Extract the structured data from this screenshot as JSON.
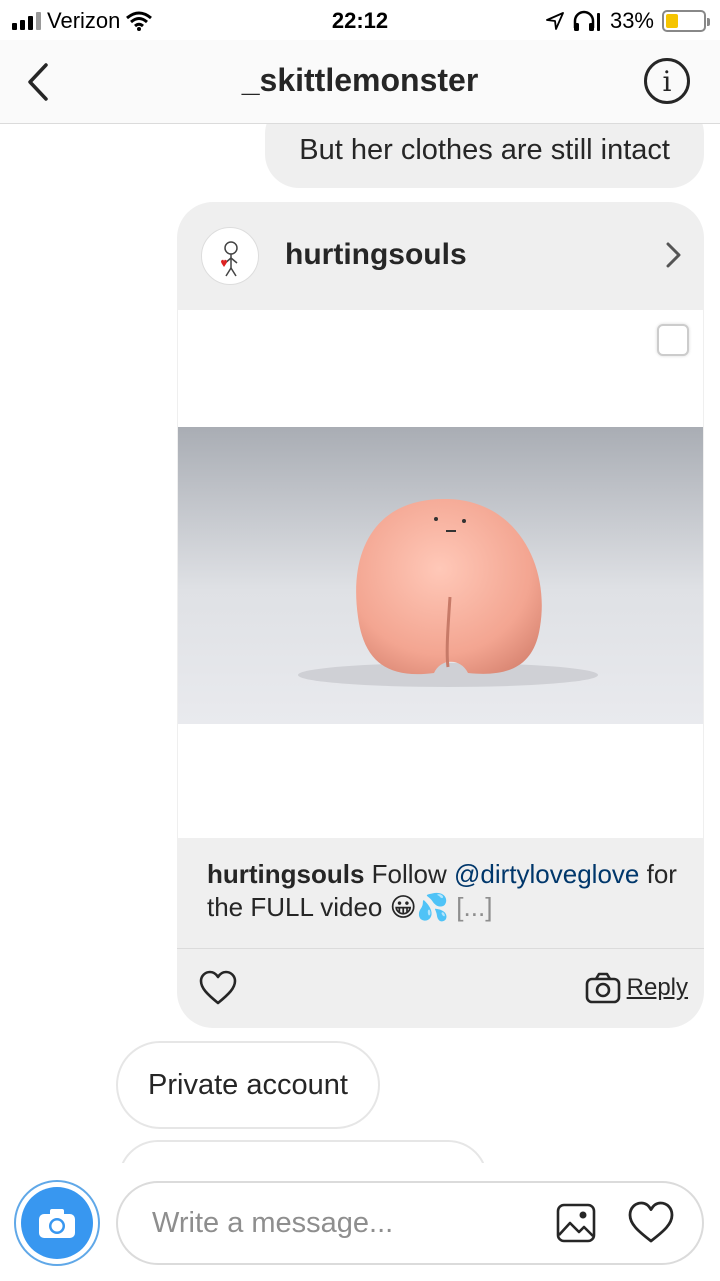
{
  "status_bar": {
    "carrier": "Verizon",
    "time": "22:12",
    "battery_percent": "33%",
    "battery_level": 0.33,
    "battery_color": "#f5c400",
    "icons": [
      "signal-icon",
      "wifi-icon",
      "location-arrow-icon",
      "headphones-icon",
      "battery-icon"
    ]
  },
  "header": {
    "title": "_skittlemonster",
    "back_icon": "chevron-left-icon",
    "info_label": "i"
  },
  "messages": {
    "top_text": "But her clothes are still intact",
    "private_text": "Private account"
  },
  "shared_post": {
    "username": "hurtingsouls",
    "caption_user": "hurtingsouls",
    "caption_prefix": " Follow ",
    "caption_mention": "@dirtyloveglove",
    "caption_suffix": " for the FULL video 😀💦 ",
    "caption_more": "[...]",
    "reply_label": "Reply",
    "icons": [
      "avatar-icon",
      "chevron-right-icon",
      "multi-select-icon",
      "heart-icon",
      "camera-icon"
    ]
  },
  "composer": {
    "placeholder": "Write a message...",
    "accent_color": "#3897f0",
    "icons": [
      "camera-icon",
      "gallery-icon",
      "heart-icon"
    ]
  }
}
